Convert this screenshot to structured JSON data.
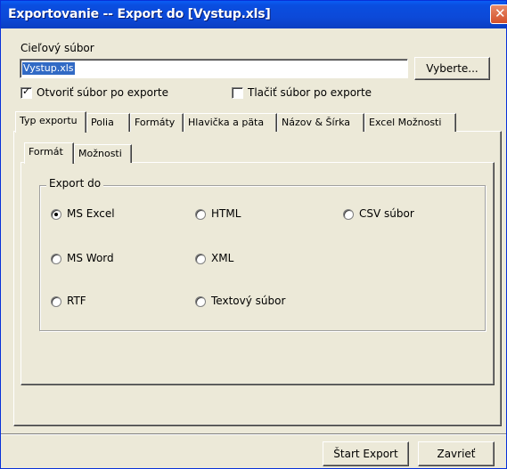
{
  "window": {
    "title": "Exportovanie -- Export do [Vystup.xls]",
    "close_glyph": "✕"
  },
  "target": {
    "label": "Cieľový súbor",
    "filename": "Vystup.xls",
    "browse_label": "Vyberte..."
  },
  "options": {
    "open_after_export": {
      "label": "Otvoriť súbor po exporte",
      "checked": true
    },
    "print_after_export": {
      "label": "Tlačiť súbor po exporte",
      "checked": false
    }
  },
  "tabs": [
    {
      "label": "Typ exportu",
      "active": true
    },
    {
      "label": "Polia",
      "active": false
    },
    {
      "label": "Formáty",
      "active": false
    },
    {
      "label": "Hlavička a päta",
      "active": false
    },
    {
      "label": "Názov & Šírka",
      "active": false
    },
    {
      "label": "Excel Možnosti",
      "active": false
    }
  ],
  "subtabs": [
    {
      "label": "Formát",
      "active": true
    },
    {
      "label": "Možnosti",
      "active": false
    }
  ],
  "export_group": {
    "title": "Export do",
    "options": [
      {
        "label": "MS Excel",
        "selected": true
      },
      {
        "label": "HTML",
        "selected": false
      },
      {
        "label": "CSV súbor",
        "selected": false
      },
      {
        "label": "MS Word",
        "selected": false
      },
      {
        "label": "XML",
        "selected": false
      },
      {
        "label": "RTF",
        "selected": false
      },
      {
        "label": "Textový súbor",
        "selected": false
      }
    ]
  },
  "buttons": {
    "start_export": "Štart Export",
    "close": "Zavrieť"
  },
  "colors": {
    "titlebar": "#0a4ee0",
    "dialog_bg": "#ece9d8",
    "selection": "#316ac5"
  }
}
